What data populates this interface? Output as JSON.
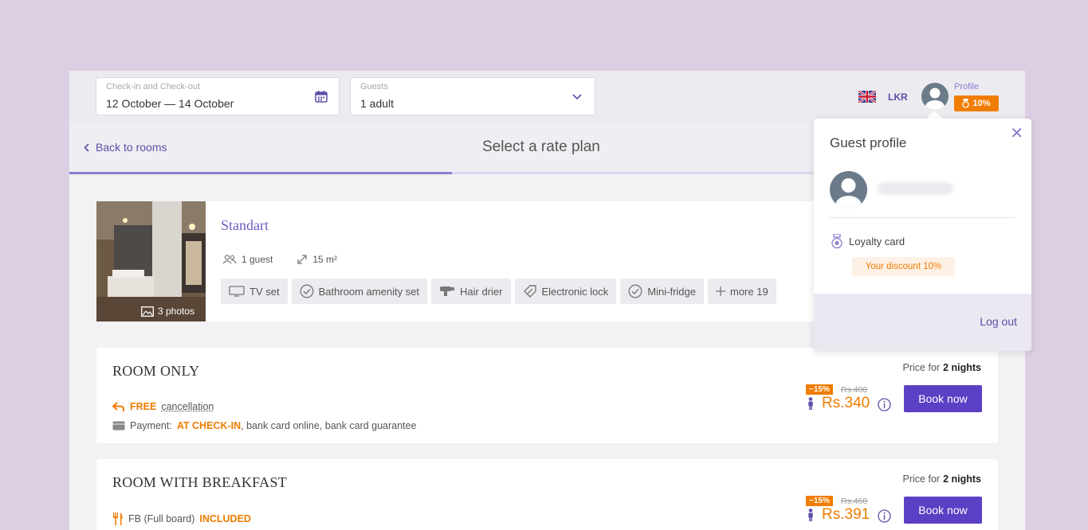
{
  "search": {
    "dates_label": "Check-in and Check-out",
    "dates_value": "12 October — 14 October",
    "guests_label": "Guests",
    "guests_value": "1 adult"
  },
  "header_right": {
    "currency": "LKR",
    "profile_label": "Profile",
    "discount_badge": "10%"
  },
  "nav": {
    "back_label": "Back to rooms",
    "page_title": "Select a rate plan",
    "progress": 0.4
  },
  "room": {
    "name": "Standart",
    "guests": "1 guest",
    "area": "15 m²",
    "photos_label": "3 photos",
    "amenities": [
      {
        "label": "TV set",
        "icon": "tv-icon"
      },
      {
        "label": "Bathroom amenity set",
        "icon": "check-circle-icon"
      },
      {
        "label": "Hair drier",
        "icon": "hair-drier-icon"
      },
      {
        "label": "Electronic lock",
        "icon": "tag-icon"
      },
      {
        "label": "Mini-fridge",
        "icon": "check-circle-icon"
      },
      {
        "label": "more 19",
        "icon": "plus-icon"
      }
    ]
  },
  "rates": [
    {
      "title": "ROOM ONLY",
      "price_for_prefix": "Price for",
      "price_for_nights": "2 nights",
      "line1_highlight": "FREE",
      "line1_text": "cancellation",
      "line2_prefix": "Payment:",
      "line2_highlight": "AT CHECK-IN",
      "line2_text": ", bank card online, bank card guarantee",
      "discount": "−15%",
      "old_price": "Rs.400",
      "new_price": "Rs.340",
      "button": "Book now"
    },
    {
      "title": "ROOM WITH BREAKFAST",
      "price_for_prefix": "Price for",
      "price_for_nights": "2 nights",
      "line1_text": "FB (Full board)",
      "line1_highlight": "INCLUDED",
      "discount": "−15%",
      "old_price": "Rs.460",
      "new_price": "Rs.391",
      "button": "Book now"
    }
  ],
  "popup": {
    "title": "Guest profile",
    "loyalty_label": "Loyalty card",
    "discount_text": "Your discount 10%",
    "logout": "Log out"
  },
  "colors": {
    "background": "#dccfe4",
    "accent": "#5b3fc4",
    "link": "#5b4ea8",
    "orange": "#f07c00"
  }
}
